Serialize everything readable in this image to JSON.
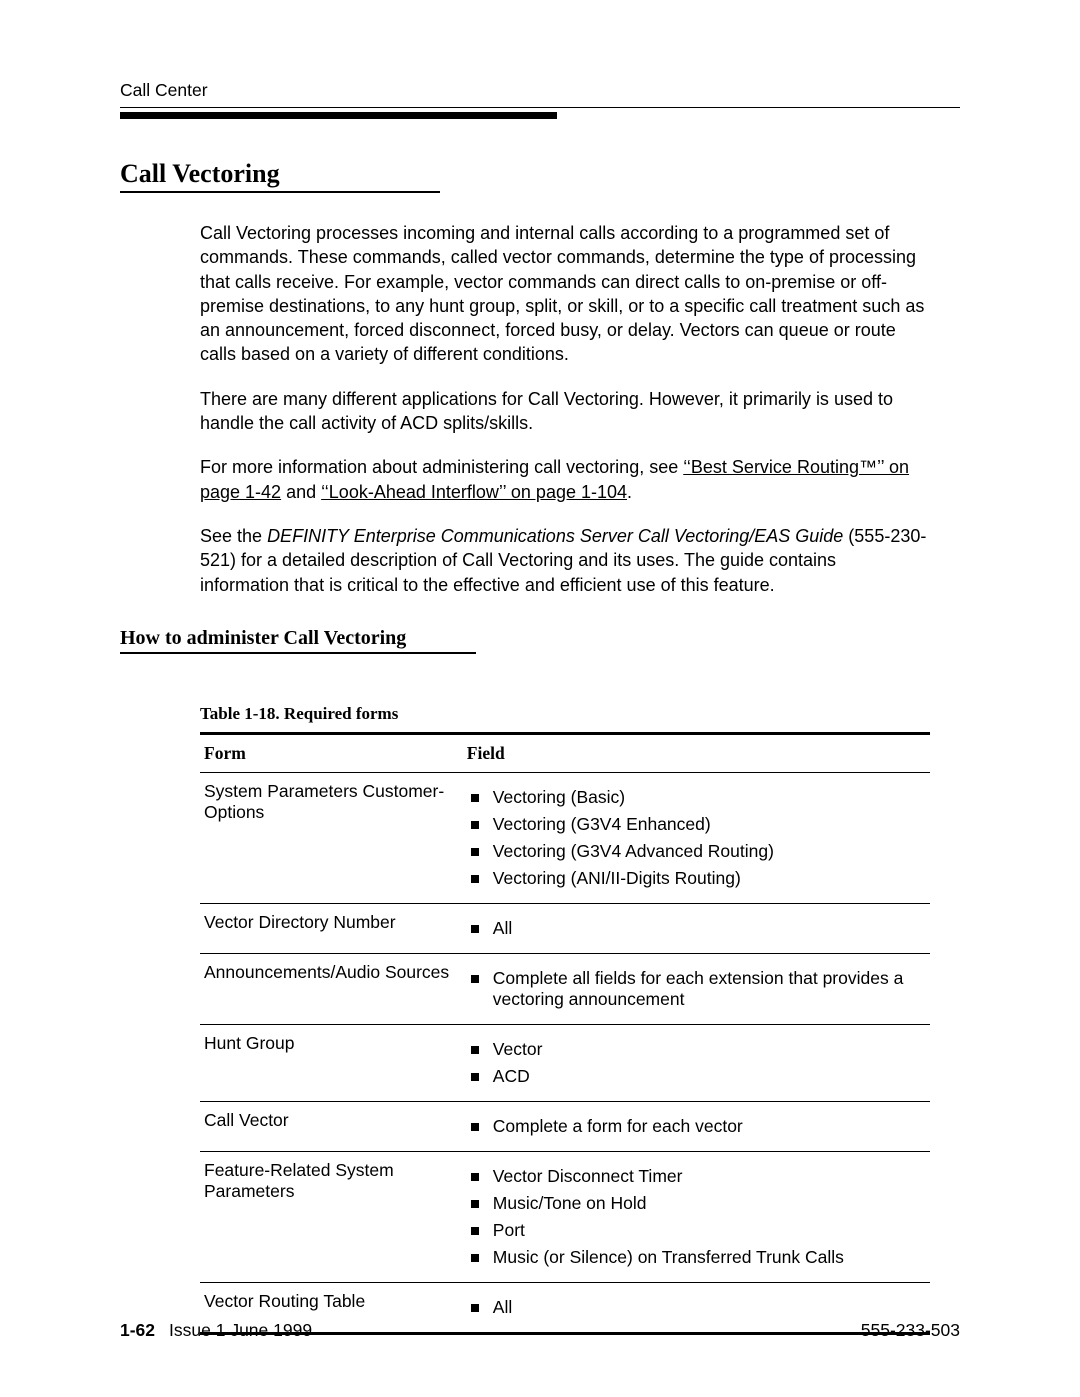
{
  "header": "Call Center",
  "section_title": "Call Vectoring",
  "paragraphs": {
    "p1": "Call Vectoring processes incoming and internal calls according to a programmed set of commands. These commands, called vector commands, determine the type of processing that calls receive. For example, vector commands can direct calls to on-premise or off-premise destinations, to any hunt group, split, or skill, or to a specific call treatment such as an announcement, forced disconnect, forced busy, or delay. Vectors can queue or route calls based on a variety of different conditions.",
    "p2": "There are many different applications for Call Vectoring. However, it primarily is used to handle the call activity of ACD splits/skills.",
    "p3_pre": "For more information about administering call vectoring, see ",
    "p3_link1": "‘‘Best Service Routing™’’ on page 1-42",
    "p3_mid": " and ",
    "p3_link2": "‘‘Look-Ahead Interflow’’ on page 1-104",
    "p3_post": ".",
    "p4_pre": "See the ",
    "p4_italic": "DEFINITY Enterprise Communications Server Call Vectoring/EAS Guide",
    "p4_post": " (555-230-521) for a detailed description of Call Vectoring and its uses. The guide contains information that is critical to the effective and efficient use of this feature."
  },
  "subsection_title": "How to administer Call Vectoring",
  "table": {
    "caption": "Table 1-18.   Required forms",
    "head": {
      "form": "Form",
      "field": "Field"
    },
    "rows": [
      {
        "form": "System Parameters Customer-Options",
        "fields": [
          "Vectoring (Basic)",
          "Vectoring (G3V4 Enhanced)",
          "Vectoring (G3V4 Advanced Routing)",
          "Vectoring (ANI/II-Digits Routing)"
        ]
      },
      {
        "form": "Vector Directory Number",
        "fields": [
          "All"
        ]
      },
      {
        "form": "Announcements/Audio Sources",
        "fields": [
          "Complete all fields for each extension that provides a vectoring announcement"
        ]
      },
      {
        "form": "Hunt Group",
        "fields": [
          "Vector",
          "ACD"
        ]
      },
      {
        "form": "Call Vector",
        "fields": [
          "Complete a form for each vector"
        ]
      },
      {
        "form": "Feature-Related System Parameters",
        "fields": [
          "Vector Disconnect Timer",
          "Music/Tone on Hold",
          "Port",
          "Music (or Silence) on Transferred Trunk Calls"
        ]
      },
      {
        "form": "Vector Routing Table",
        "fields": [
          "All"
        ]
      }
    ]
  },
  "footer": {
    "page_number": "1-62",
    "issue": "Issue 1 June 1999",
    "doc_number": "555-233-503"
  }
}
